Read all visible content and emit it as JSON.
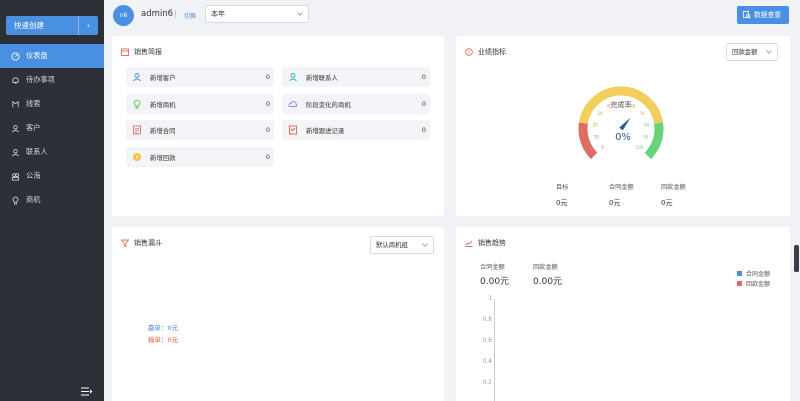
{
  "sidebar": {
    "quick_create": "快速创建",
    "items": [
      {
        "label": "仪表盘",
        "icon": "dashboard-icon",
        "active": true
      },
      {
        "label": "待办事项",
        "icon": "bell-icon"
      },
      {
        "label": "线索",
        "icon": "lead-icon"
      },
      {
        "label": "客户",
        "icon": "customer-icon"
      },
      {
        "label": "联系人",
        "icon": "contact-icon"
      },
      {
        "label": "公海",
        "icon": "public-pool-icon"
      },
      {
        "label": "商机",
        "icon": "bulb-icon"
      }
    ]
  },
  "header": {
    "avatar_text": "n6",
    "username": "admin6",
    "switch_label": "切换",
    "period_value": "本年",
    "data_button": "数据查重"
  },
  "sales_brief": {
    "title": "销售简报",
    "items": [
      {
        "label": "新增客户",
        "value": "0",
        "icon": "customer-icon",
        "color": "#4a90e2"
      },
      {
        "label": "新增联系人",
        "value": "0",
        "icon": "contact-icon",
        "color": "#27b6a8"
      },
      {
        "label": "新增商机",
        "value": "0",
        "icon": "bulb-icon",
        "color": "#67c23a"
      },
      {
        "label": "阶段变化的商机",
        "value": "0",
        "icon": "cloud-icon",
        "color": "#b07cd9"
      },
      {
        "label": "新增合同",
        "value": "0",
        "icon": "contract-icon",
        "color": "#e8603c"
      },
      {
        "label": "新增跟进记录",
        "value": "0",
        "icon": "follow-icon",
        "color": "#e8603c"
      },
      {
        "label": "新增回款",
        "value": "0",
        "icon": "coin-icon",
        "color": "#f5c242"
      }
    ]
  },
  "kpi": {
    "title": "业绩指标",
    "select_value": "回款金额",
    "gauge_label": "完成率",
    "gauge_value": "0%",
    "gauge_percent": 0,
    "gauge_ticks": [
      "0",
      "10",
      "20",
      "30",
      "40",
      "50",
      "60",
      "70",
      "80",
      "90",
      "100"
    ],
    "metrics": [
      {
        "label": "目标",
        "value": "0元"
      },
      {
        "label": "合同金额",
        "value": "0元"
      },
      {
        "label": "回款金额",
        "value": "0元"
      }
    ],
    "colors": {
      "low": "#e06c66",
      "mid": "#f2cf5c",
      "high": "#67d37a",
      "pointer": "#2c5a8c"
    }
  },
  "funnel": {
    "title": "销售漏斗",
    "select_value": "默认商机组",
    "win_label": "赢单：0元",
    "lose_label": "输单：0元"
  },
  "trend": {
    "title": "销售趋势",
    "contract_label": "合同金额",
    "contract_value": "0.00元",
    "payment_label": "回款金额",
    "payment_value": "0.00元",
    "legend": [
      {
        "label": "合同金额",
        "color": "#4a90e2"
      },
      {
        "label": "回款金额",
        "color": "#e06c66"
      }
    ],
    "y_ticks": [
      "1",
      "0.8",
      "0.6",
      "0.4",
      "0.2"
    ]
  }
}
